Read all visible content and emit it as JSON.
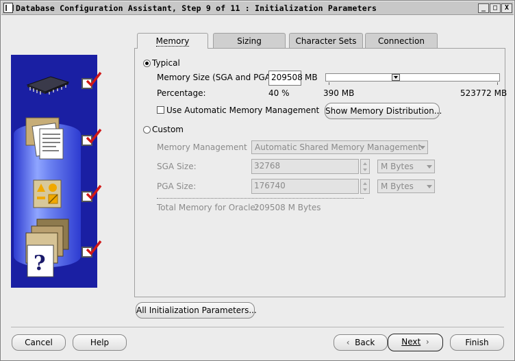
{
  "window": {
    "title": "Database Configuration Assistant, Step 9 of 11 : Initialization Parameters",
    "controls": [
      "_",
      "□",
      "X"
    ]
  },
  "tabs": [
    {
      "label": "Memory",
      "active": true
    },
    {
      "label": "Sizing",
      "active": false
    },
    {
      "label": "Character Sets",
      "active": false
    },
    {
      "label": "Connection Mode",
      "active": false
    }
  ],
  "memory": {
    "typical_label": "Typical",
    "typical_selected": true,
    "memory_size_label": "Memory Size (SGA and PGA):",
    "memory_size_value": "209508",
    "memory_size_unit": "MB",
    "percentage_label": "Percentage:",
    "percentage_value": "40 %",
    "slider_min": "390 MB",
    "slider_max": "523772 MB",
    "slider_fraction": 0.4,
    "amm_checkbox_label": "Use Automatic Memory Management",
    "amm_checked": false,
    "show_distribution_button": "Show Memory Distribution...",
    "custom_label": "Custom",
    "custom_selected": false,
    "memory_mgmt_label": "Memory Management",
    "memory_mgmt_value": "Automatic Shared Memory Management",
    "sga_label": "SGA Size:",
    "sga_value": "32768",
    "sga_unit": "M Bytes",
    "pga_label": "PGA Size:",
    "pga_value": "176740",
    "pga_unit": "M Bytes",
    "total_label": "Total Memory for Oracle:",
    "total_value": "209508 M Bytes"
  },
  "all_params_button": "All Initialization Parameters...",
  "footer": {
    "cancel": "Cancel",
    "help": "Help",
    "back": "Back",
    "next": "Next",
    "finish": "Finish"
  },
  "colors": {
    "side_panel": "#1a1fa3",
    "check_red": "#d01818"
  },
  "side_icons": [
    "chip-icon",
    "documents-icon",
    "shapes-icon",
    "folder-question-icon"
  ]
}
